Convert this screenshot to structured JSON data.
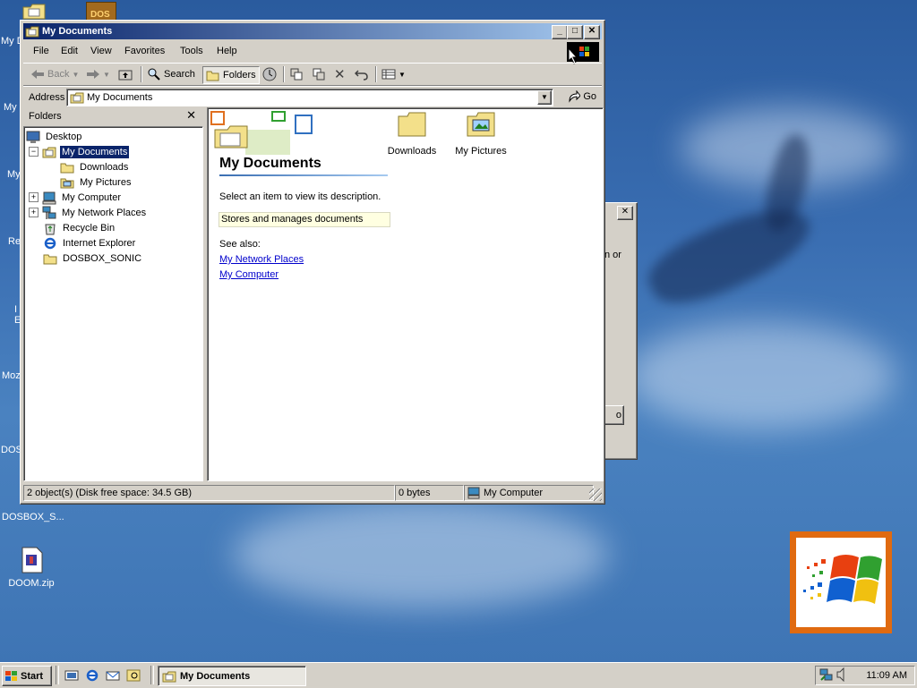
{
  "desktop": {
    "icons": {
      "my_documents_partial": "My D",
      "row2_partial": "My",
      "row3_partial": "My",
      "recycle_partial": "Re",
      "ie_partial_1": "I",
      "ie_partial_2": "E",
      "mozilla_partial": "Moz",
      "dosbox_partial": "DOS",
      "dosbox_sonic": "DOSBOX_S...",
      "doom": "DOOM.zip",
      "dos_icon_text": "DOS"
    }
  },
  "background_dialog": {
    "partial_text": "n or",
    "partial_button": "o"
  },
  "window": {
    "title": "My Documents",
    "caption_buttons": {
      "minimize": "_",
      "maximize": "□",
      "close": "✕"
    },
    "menu": [
      "File",
      "Edit",
      "View",
      "Favorites",
      "Tools",
      "Help"
    ],
    "toolbar": {
      "back": "Back",
      "search": "Search",
      "folders": "Folders"
    },
    "address": {
      "label": "Address",
      "value": "My Documents",
      "go": "Go"
    },
    "folders_pane": {
      "title": "Folders",
      "tree": [
        {
          "label": "Desktop",
          "level": 0,
          "icon": "desktop-icon"
        },
        {
          "label": "My Documents",
          "level": 1,
          "icon": "my-documents-icon",
          "selected": true,
          "expander": "−"
        },
        {
          "label": "Downloads",
          "level": 2,
          "icon": "folder-icon"
        },
        {
          "label": "My Pictures",
          "level": 2,
          "icon": "my-pictures-icon"
        },
        {
          "label": "My Computer",
          "level": 1,
          "icon": "computer-icon",
          "expander": "+"
        },
        {
          "label": "My Network Places",
          "level": 1,
          "icon": "network-icon",
          "expander": "+"
        },
        {
          "label": "Recycle Bin",
          "level": 1,
          "icon": "recycle-bin-icon"
        },
        {
          "label": "Internet Explorer",
          "level": 1,
          "icon": "ie-icon"
        },
        {
          "label": "DOSBOX_SONIC",
          "level": 1,
          "icon": "folder-icon"
        }
      ]
    },
    "content": {
      "heading": "My Documents",
      "select_prompt": "Select an item to view its description.",
      "description": "Stores and manages documents",
      "see_also": "See also:",
      "links": [
        "My Network Places",
        "My Computer"
      ],
      "items": [
        {
          "label": "Downloads",
          "icon": "folder-icon"
        },
        {
          "label": "My Pictures",
          "icon": "my-pictures-icon"
        }
      ]
    },
    "status": {
      "objects": "2 object(s) (Disk free space: 34.5 GB)",
      "size": "0 bytes",
      "location": "My Computer"
    }
  },
  "taskbar": {
    "start": "Start",
    "task_button": "My Documents",
    "clock": "11:09 AM"
  },
  "colors": {
    "title_active_start": "#0a246a",
    "title_active_end": "#a6caf0",
    "face": "#d4d0c8",
    "link": "#0000cc",
    "selection": "#0a246a"
  }
}
